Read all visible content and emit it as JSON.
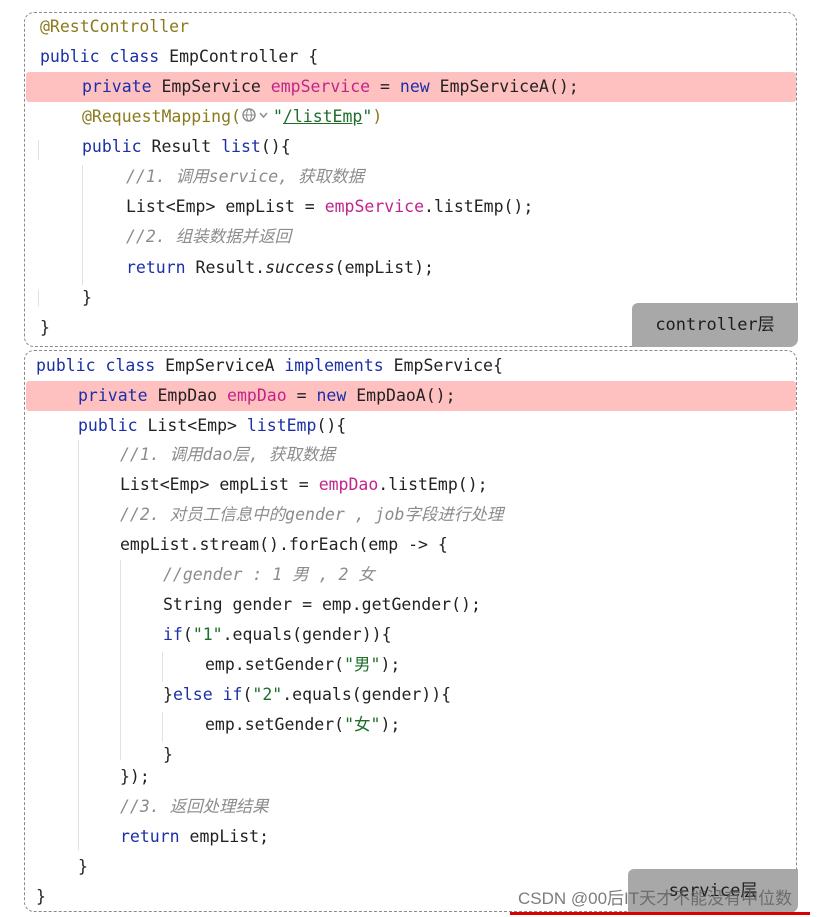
{
  "panel1": {
    "tag": "controller层",
    "lines": [
      "@RestController",
      "public class EmpController {",
      "private EmpService empService = new EmpServiceA();",
      "@RequestMapping(\"/listEmp\")",
      "public Result list(){",
      "//1. 调用service, 获取数据",
      "List<Emp> empList = empService.listEmp();",
      "//2. 组装数据并返回",
      "return Result.success(empList);",
      "}",
      "}"
    ]
  },
  "panel2": {
    "tag": "service层",
    "lines": [
      "public class EmpServiceA implements EmpService{",
      "private EmpDao empDao = new EmpDaoA();",
      "public List<Emp> listEmp(){",
      "//1. 调用dao层, 获取数据",
      "List<Emp> empList = empDao.listEmp();",
      "//2. 对员工信息中的gender , job字段进行处理",
      "empList.stream().forEach(emp -> {",
      "//gender : 1 男 , 2 女",
      "String gender = emp.getGender();",
      "if(\"1\".equals(gender)){",
      "emp.setGender(\"男\");",
      "}else if(\"2\".equals(gender)){",
      "emp.setGender(\"女\");",
      "}",
      "});",
      "//3. 返回处理结果",
      "return empList;",
      "}",
      "}"
    ]
  },
  "watermark": "CSDN @00后IT天才不能没有中位数"
}
